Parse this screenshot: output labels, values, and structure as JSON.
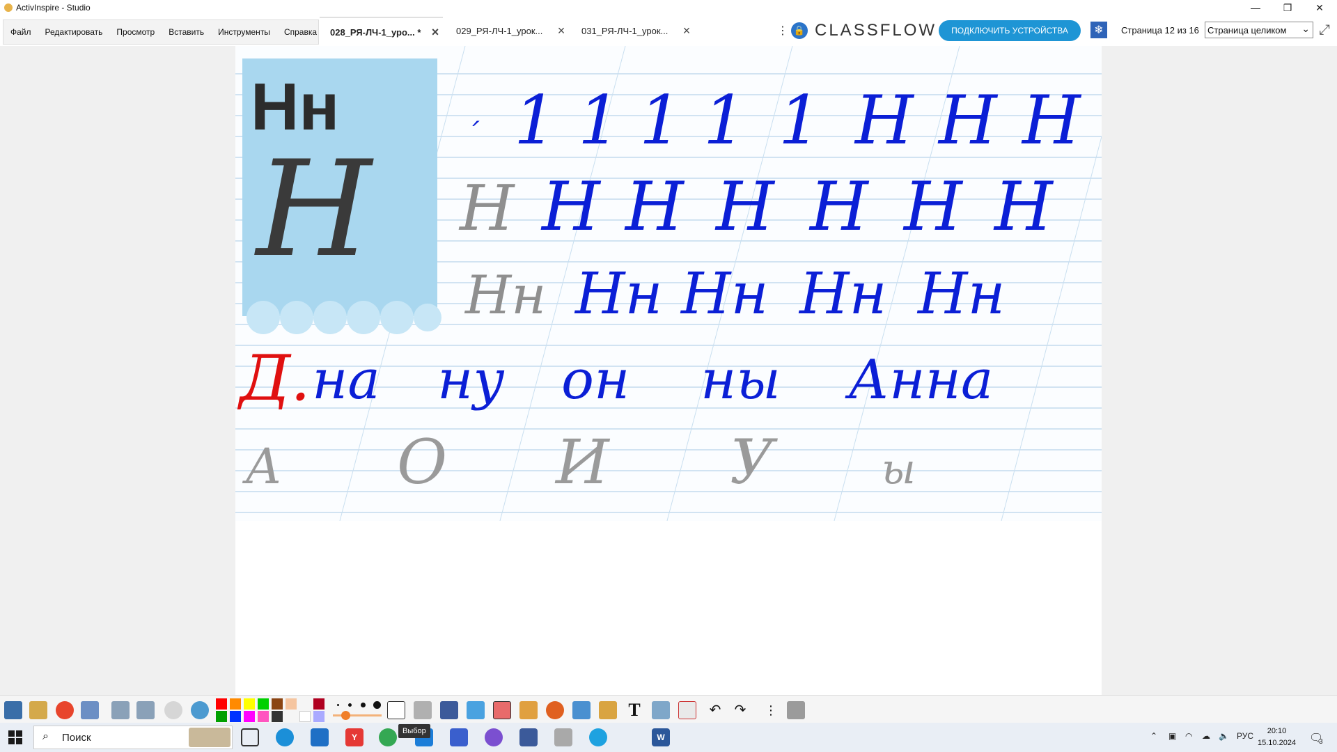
{
  "window": {
    "title": "ActivInspire - Studio"
  },
  "menu": {
    "items": [
      "Файл",
      "Редактировать",
      "Просмотр",
      "Вставить",
      "Инструменты",
      "Справка"
    ]
  },
  "tabs": [
    {
      "label": "028_РЯ-ЛЧ-1_уро... *",
      "active": true
    },
    {
      "label": "029_РЯ-ЛЧ-1_урок...",
      "active": false
    },
    {
      "label": "031_РЯ-ЛЧ-1_урок...",
      "active": false
    }
  ],
  "classflow": {
    "logo": "CLASSFLOW",
    "connect_label": "ПОДКЛЮЧИТЬ УСТРОЙСТВА"
  },
  "page_counter": "Страница 12 из 16",
  "zoom": {
    "value": "Страница целиком"
  },
  "lesson": {
    "letter_print": "Нн",
    "row1": [
      "1",
      "1",
      "1",
      "1",
      "1",
      "Н",
      "Н",
      "Н"
    ],
    "row2_trace": "Н",
    "row2": [
      "Н",
      "Н",
      "Н",
      "Н",
      "Н",
      "Н"
    ],
    "row3_trace": "Нн",
    "row3": [
      "Нн",
      "Нн",
      "Нн",
      "Нн"
    ],
    "dictation_mark": "Д.",
    "words": [
      "на",
      "ну",
      "он",
      "ны",
      "Анна"
    ],
    "bottom_letters": [
      "А",
      "О",
      "И",
      "У",
      "ы"
    ]
  },
  "toolbar": {
    "colors": [
      "#ff0000",
      "#ff8a00",
      "#ffff00",
      "#00d000",
      "#8b4513",
      "#f5c5a0",
      "#b00020",
      "#00a000",
      "#0033ff",
      "#ff00ff",
      "#ff55c0",
      "#333333",
      "#ffffff",
      "#aaaaff"
    ]
  },
  "taskbar": {
    "search_placeholder": "Поиск",
    "tooltip": "Выбор",
    "language": "РУС",
    "time": "20:10",
    "date": "15.10.2024",
    "notifications": "3"
  }
}
